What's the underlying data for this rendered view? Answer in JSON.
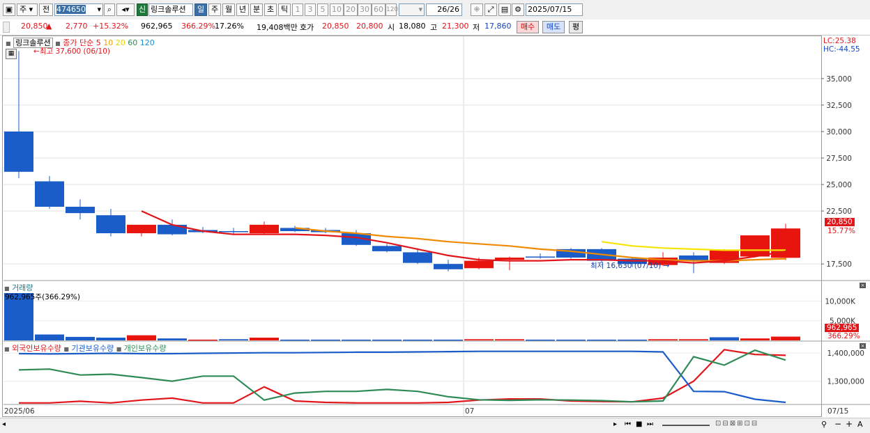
{
  "toolbar": {
    "type_label": "주",
    "prev_label": "전",
    "code_value": "474650",
    "name_badge": "신",
    "stock_name": "링크솔루션",
    "periods": [
      "일",
      "주",
      "월",
      "년",
      "분",
      "초",
      "틱"
    ],
    "minutes": [
      "1",
      "3",
      "5",
      "10",
      "20",
      "30",
      "60",
      "120"
    ],
    "count_value": "26/26",
    "date_value": "2025/07/15"
  },
  "infobar": {
    "price": "20,850",
    "change_arrow": "▲",
    "change": "2,770",
    "change_pct": "+15.32%",
    "volume": "962,965",
    "volume_pct": "366.29%",
    "turnover_pct": "17.26%",
    "amount": "19,408백만",
    "quote_label": "호가",
    "ask": "20,850",
    "bid": "20,800",
    "open_label": "시",
    "open": "18,080",
    "high_label": "고",
    "high": "21,300",
    "low_label": "저",
    "low": "17,860",
    "buy_label": "매수",
    "sell_label": "매도",
    "eval_label": "평"
  },
  "price_panel": {
    "title": "링크솔루션",
    "legend_label": "종가 단순",
    "ma_periods": [
      "5",
      "10",
      "20",
      "60",
      "120"
    ],
    "max_note": "최고 37,600 (06/10)",
    "min_note": "최저 16,630 (07/10)",
    "lc_label": "LC:25.38",
    "hc_label": "HC:-44.55",
    "last_price_tag": "20,850",
    "last_pct_tag": "15.77%"
  },
  "volume_panel": {
    "title": "거래량",
    "current_note": "962,965주(366.29%)",
    "tag_value": "962,965",
    "tag_pct": "366.29%"
  },
  "holding_panel": {
    "legend": [
      "외국인보유수량",
      "기관보유수량",
      "개인보유수량"
    ]
  },
  "xaxis": {
    "start": "2025/06",
    "mid": "07",
    "end": "07/15"
  },
  "colors": {
    "up": "#e8150f",
    "down": "#1a5cc8",
    "ma5": "#e0161b",
    "ma10": "#f08a00",
    "ma20": "#f5e400",
    "ma60": "#2e8b57",
    "ma120": "#1a8fd0"
  },
  "chart_data": [
    {
      "type": "candlestick",
      "title": "링크솔루션",
      "y_ticks": [
        35000,
        32500,
        30000,
        27500,
        25000,
        22500,
        17500
      ],
      "ylim": [
        16000,
        39000
      ],
      "candles": [
        {
          "o": 30000,
          "h": 37600,
          "l": 25600,
          "c": 26200
        },
        {
          "o": 25300,
          "h": 25800,
          "l": 22700,
          "c": 22900
        },
        {
          "o": 22900,
          "h": 23600,
          "l": 21700,
          "c": 22300
        },
        {
          "o": 22100,
          "h": 22700,
          "l": 20100,
          "c": 20400
        },
        {
          "o": 20400,
          "h": 21200,
          "l": 20100,
          "c": 21200
        },
        {
          "o": 21200,
          "h": 21700,
          "l": 20200,
          "c": 20300
        },
        {
          "o": 20700,
          "h": 21000,
          "l": 20400,
          "c": 20500
        },
        {
          "o": 20600,
          "h": 20900,
          "l": 20300,
          "c": 20500
        },
        {
          "o": 20400,
          "h": 21500,
          "l": 20300,
          "c": 21200
        },
        {
          "o": 20900,
          "h": 21100,
          "l": 20500,
          "c": 20600
        },
        {
          "o": 20700,
          "h": 20900,
          "l": 20400,
          "c": 20500
        },
        {
          "o": 20400,
          "h": 20700,
          "l": 19200,
          "c": 19300
        },
        {
          "o": 19200,
          "h": 19400,
          "l": 18600,
          "c": 18700
        },
        {
          "o": 18600,
          "h": 19000,
          "l": 17500,
          "c": 17600
        },
        {
          "o": 17500,
          "h": 17900,
          "l": 16800,
          "c": 17000
        },
        {
          "o": 17100,
          "h": 18100,
          "l": 17000,
          "c": 17800
        },
        {
          "o": 17900,
          "h": 18200,
          "l": 16900,
          "c": 18100
        },
        {
          "o": 18200,
          "h": 18500,
          "l": 18000,
          "c": 18100
        },
        {
          "o": 18900,
          "h": 19000,
          "l": 18000,
          "c": 18100
        },
        {
          "o": 18900,
          "h": 19000,
          "l": 17600,
          "c": 17800
        },
        {
          "o": 18000,
          "h": 18100,
          "l": 17200,
          "c": 17500
        },
        {
          "o": 17400,
          "h": 18600,
          "l": 17300,
          "c": 18100
        },
        {
          "o": 18300,
          "h": 18600,
          "l": 16630,
          "c": 17800
        },
        {
          "o": 17600,
          "h": 18900,
          "l": 17500,
          "c": 18800
        },
        {
          "o": 18200,
          "h": 18300,
          "l": 18100,
          "c": 20200
        },
        {
          "o": 18080,
          "h": 21300,
          "l": 17860,
          "c": 20850
        }
      ],
      "ma5": [
        null,
        null,
        null,
        null,
        22500,
        21200,
        20600,
        20300,
        20300,
        20300,
        20200,
        20000,
        19500,
        18900,
        18300,
        17900,
        17800,
        17800,
        17900,
        17900,
        17800,
        17800,
        17600,
        17800,
        18200,
        18700
      ],
      "ma10": [
        null,
        null,
        null,
        null,
        null,
        null,
        null,
        null,
        null,
        20900,
        20600,
        20400,
        20100,
        19900,
        19600,
        19400,
        19200,
        18900,
        18700,
        18400,
        18100,
        17900,
        17800,
        17800,
        17900,
        18000
      ],
      "ma20": [
        null,
        null,
        null,
        null,
        null,
        null,
        null,
        null,
        null,
        null,
        null,
        null,
        null,
        null,
        null,
        null,
        null,
        null,
        null,
        19600,
        19200,
        19000,
        18900,
        18800,
        18800,
        18800
      ]
    },
    {
      "type": "bar",
      "title": "거래량",
      "y_ticks": [
        "10,000K",
        "5,000K"
      ],
      "ylim": [
        0,
        15000000
      ],
      "values": [
        12000000,
        1500000,
        900000,
        700000,
        1300000,
        500000,
        200000,
        300000,
        700000,
        200000,
        200000,
        200000,
        200000,
        200000,
        200000,
        300000,
        300000,
        200000,
        200000,
        200000,
        200000,
        300000,
        300000,
        800000,
        500000,
        962965
      ],
      "up": [
        false,
        false,
        false,
        false,
        true,
        false,
        true,
        false,
        true,
        false,
        false,
        false,
        false,
        false,
        false,
        true,
        true,
        false,
        false,
        false,
        false,
        true,
        true,
        false,
        true,
        true
      ]
    },
    {
      "type": "line",
      "title": "외국인보유수량 / 기관보유수량 / 개인보유수량",
      "y_ticks": [
        1400000,
        1300000
      ],
      "ylim": [
        1220000,
        1430000
      ],
      "series": [
        {
          "name": "외국인보유수량",
          "color": "#e0161b",
          "values": [
            1223000,
            1223000,
            1229000,
            1223000,
            1233000,
            1240000,
            1223000,
            1223000,
            1280000,
            1230000,
            1225000,
            1223000,
            1223000,
            1223000,
            1225000,
            1233000,
            1237000,
            1237000,
            1230000,
            1228000,
            1227000,
            1240000,
            1300000,
            1412000,
            1395000,
            1392000
          ]
        },
        {
          "name": "기관보유수량",
          "color": "#1a5cc8",
          "values": [
            1398000,
            1397000,
            1398000,
            1399000,
            1398000,
            1398000,
            1399000,
            1400000,
            1401000,
            1401000,
            1402000,
            1403000,
            1403000,
            1404000,
            1405000,
            1406000,
            1406000,
            1406000,
            1406000,
            1406000,
            1406000,
            1404000,
            1264000,
            1263000,
            1236000,
            1225000
          ]
        },
        {
          "name": "개인보유수량",
          "color": "#2e8b57",
          "values": [
            1340000,
            1343000,
            1322000,
            1325000,
            1313000,
            1300000,
            1318000,
            1318000,
            1233000,
            1258000,
            1264000,
            1264000,
            1271000,
            1264000,
            1245000,
            1234000,
            1232000,
            1234000,
            1233000,
            1231000,
            1227000,
            1230000,
            1387000,
            1357000,
            1410000,
            1375000
          ]
        }
      ]
    }
  ]
}
